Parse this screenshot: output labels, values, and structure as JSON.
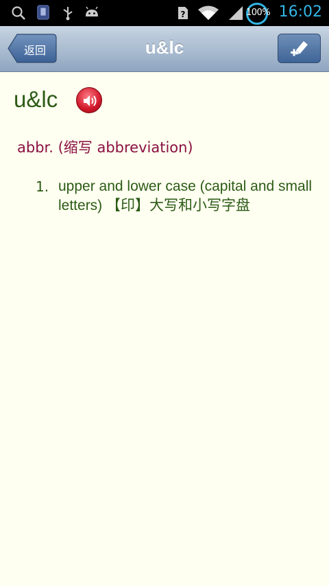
{
  "status_bar": {
    "battery": "100%",
    "time": "16:02",
    "icons": [
      "search-icon",
      "phone-icon",
      "usb-icon",
      "android-icon",
      "sim-unknown-icon",
      "wifi-icon",
      "signal-icon"
    ],
    "accent_color": "#33b5e5"
  },
  "header": {
    "back_label": "返回",
    "title": "u&lc"
  },
  "entry": {
    "headword": "u&lc",
    "part_of_speech": "abbr. (缩写 abbreviation)",
    "senses": [
      {
        "number": "1.",
        "text": "upper and lower case (capital and small letters) 【印】大写和小写字盘"
      }
    ]
  },
  "colors": {
    "headword": "#2c5a16",
    "part_of_speech": "#8b1042",
    "background": "#fefff0"
  }
}
